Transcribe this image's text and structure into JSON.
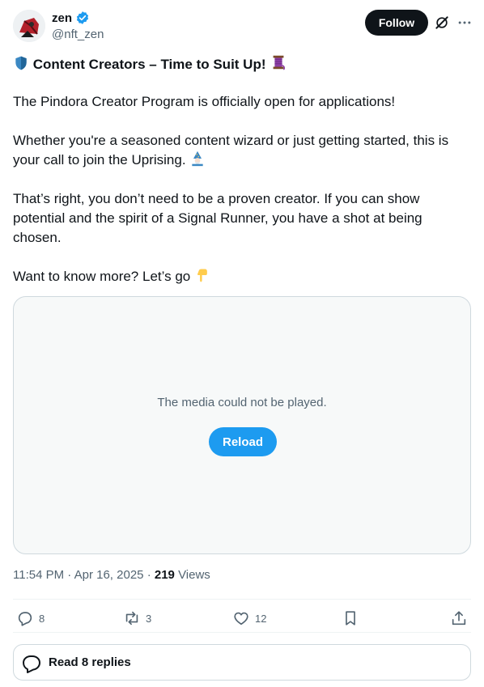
{
  "author": {
    "name": "zen",
    "handle": "@nft_zen",
    "verified": true
  },
  "header": {
    "follow_label": "Follow"
  },
  "tweet": {
    "title_emoji_left": "🛡️",
    "title": "Content Creators – Time to Suit Up!",
    "title_emoji_right": "🧵",
    "p1": "The Pindora Creator Program is officially open for applications!",
    "p2": "Whether you're a seasoned content wizard or just getting started, this is your call to join the Uprising.",
    "p2_emoji": "🧙",
    "p3": "That’s right, you don’t need to be a proven creator. If you can show potential and the spirit of a Signal Runner, you have a shot at being chosen.",
    "p4": "Want to know more? Let’s go",
    "p4_emoji": "👇"
  },
  "media": {
    "message": "The media could not be played.",
    "reload_label": "Reload"
  },
  "meta": {
    "time": "11:54 PM",
    "sep1": "·",
    "date": "Apr 16, 2025",
    "sep2": "·",
    "views_count": "219",
    "views_label": "Views"
  },
  "actions": {
    "replies": "8",
    "reposts": "3",
    "likes": "12"
  },
  "footer": {
    "read_replies_label": "Read 8 replies"
  },
  "colors": {
    "accent": "#1d9bf0",
    "text": "#0f1419",
    "secondary": "#536471",
    "border": "#cfd9de"
  }
}
